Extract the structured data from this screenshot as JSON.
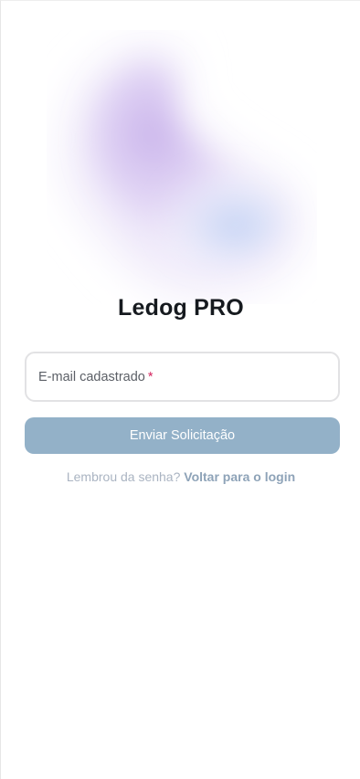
{
  "brand": {
    "title": "Ledog PRO"
  },
  "form": {
    "email_label": "E-mail cadastrado",
    "required_marker": "*",
    "submit_label": "Enviar Solicitação"
  },
  "footer": {
    "prompt": "Lembrou da senha?",
    "link": "Voltar para o login"
  },
  "colors": {
    "button_bg": "#93b1c8",
    "required": "#d4245e",
    "link": "#8ea3b8",
    "blob_purple": "#c9b3ea",
    "blob_blue": "#b9cdf2"
  }
}
